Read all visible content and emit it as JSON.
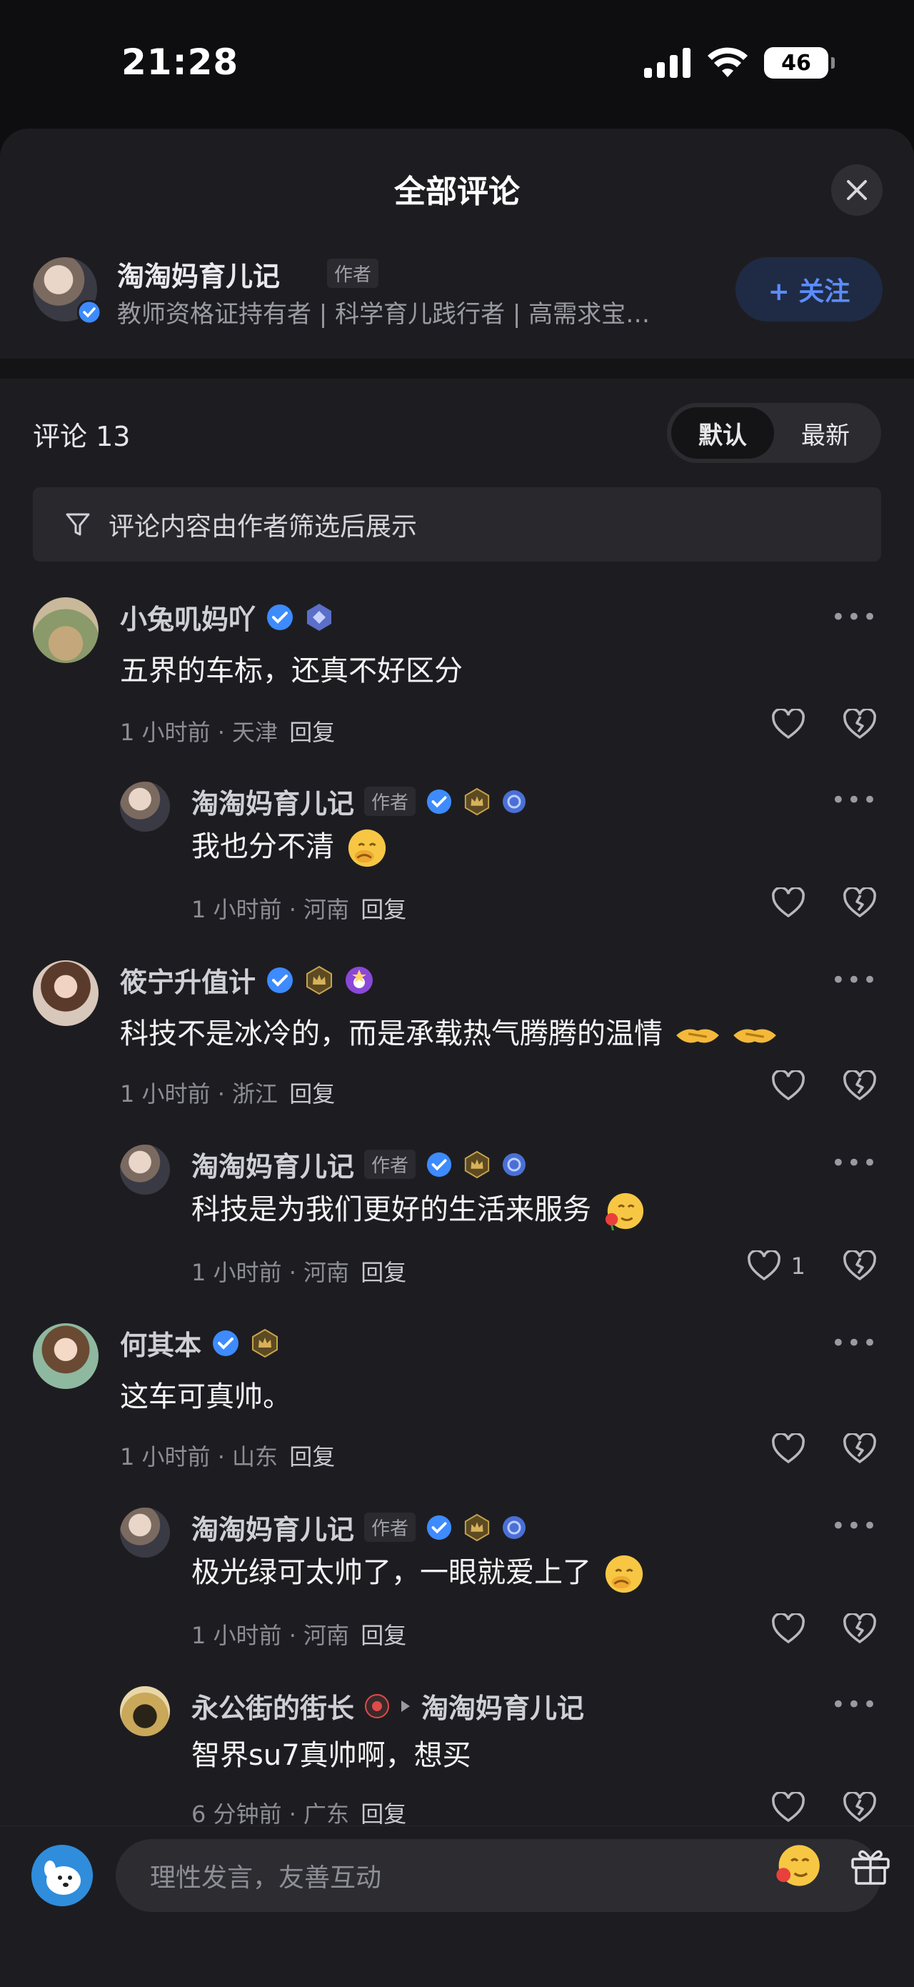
{
  "status_bar": {
    "time": "21:28",
    "battery": "46"
  },
  "sheet": {
    "title": "全部评论"
  },
  "author": {
    "name": "淘淘妈育儿记",
    "tag": "作者",
    "bio": "教师资格证持有者 | 科学育儿践行者 | 高需求宝…",
    "follow_label": "+ 关注"
  },
  "comments_header": {
    "count_label": "评论 13",
    "sort_options": [
      "默认",
      "最新"
    ],
    "active_sort": "默认",
    "filter_note": "评论内容由作者筛选后展示"
  },
  "comments": [
    {
      "name": "小兔叽妈吖",
      "text": "五界的车标，还真不好区分",
      "meta": "1 小时前 · 天津",
      "reply": "回复",
      "likes": ""
    },
    {
      "name": "淘淘妈育儿记",
      "tag": "作者",
      "text": "我也分不清",
      "meta": "1 小时前 · 河南",
      "reply": "回复",
      "likes": ""
    },
    {
      "name": "筱宁升值计",
      "text": "科技不是冰冷的，而是承载热气腾腾的温情",
      "meta": "1 小时前 · 浙江",
      "reply": "回复",
      "likes": ""
    },
    {
      "name": "淘淘妈育儿记",
      "tag": "作者",
      "text": "科技是为我们更好的生活来服务",
      "meta": "1 小时前 · 河南",
      "reply": "回复",
      "likes": "1"
    },
    {
      "name": "何其本",
      "text": "这车可真帅。",
      "meta": "1 小时前 · 山东",
      "reply": "回复",
      "likes": ""
    },
    {
      "name": "淘淘妈育儿记",
      "tag": "作者",
      "text": "极光绿可太帅了，一眼就爱上了",
      "meta": "1 小时前 · 河南",
      "reply": "回复",
      "likes": ""
    },
    {
      "name": "永公街的街长",
      "reply_to": "淘淘妈育儿记",
      "text": "智界su7真帅啊，想买",
      "meta": "6 分钟前 · 广东",
      "reply": "回复",
      "likes": ""
    }
  ],
  "input": {
    "placeholder": "理性发言，友善互动"
  },
  "colors": {
    "accent": "#5b8cff",
    "verified": "#3d8bff",
    "bg": "#1d1d21"
  }
}
